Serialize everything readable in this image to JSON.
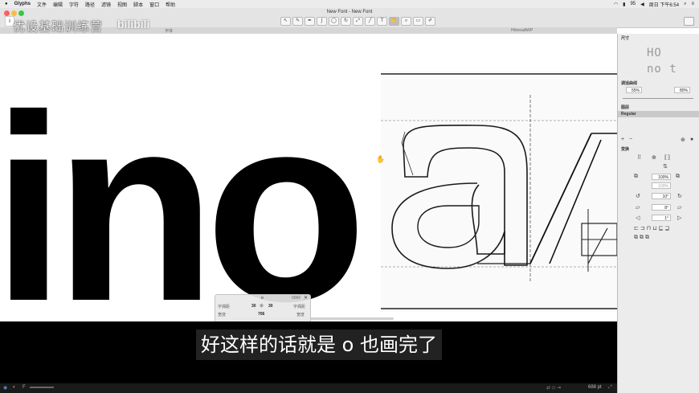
{
  "menubar": {
    "apple": "",
    "app": "Glyphs",
    "items": [
      "文件",
      "编辑",
      "字符",
      "路径",
      "滤镜",
      "视图",
      "脚本",
      "窗口",
      "帮助"
    ],
    "status": {
      "battery": "95",
      "clock": "周日 下午6:54"
    }
  },
  "window": {
    "title": "New Font - New Font"
  },
  "tabs": {
    "left": "字体",
    "right": "HhinoaAWP"
  },
  "watermark": {
    "text": "优设基础训练营",
    "logo": "bilibili"
  },
  "canvas": {
    "text": "ino",
    "zoom_label": "688 pt"
  },
  "infobox": {
    "glyph": "o",
    "unicode": "006F",
    "lsb_label": "字偶距",
    "lsb": "30",
    "rsb": "30",
    "rsb_label": "字偶距",
    "width_label": "宽度",
    "width": "706",
    "kern_label": "宽度"
  },
  "subtitle": "好这样的话就是 o 也画完了",
  "panel": {
    "dims_header": "尺寸",
    "preview_line1": "HO",
    "preview_line2": "no t",
    "smooth_header": "调适曲线",
    "smooth_left": "55%",
    "smooth_right": "80%",
    "layers_header": "图层",
    "layer_name": "Regular",
    "transform_header": "变换",
    "scale": "100%",
    "scale2": "100%",
    "rotate": "10°",
    "slant": "8°",
    "skew": "1°"
  }
}
